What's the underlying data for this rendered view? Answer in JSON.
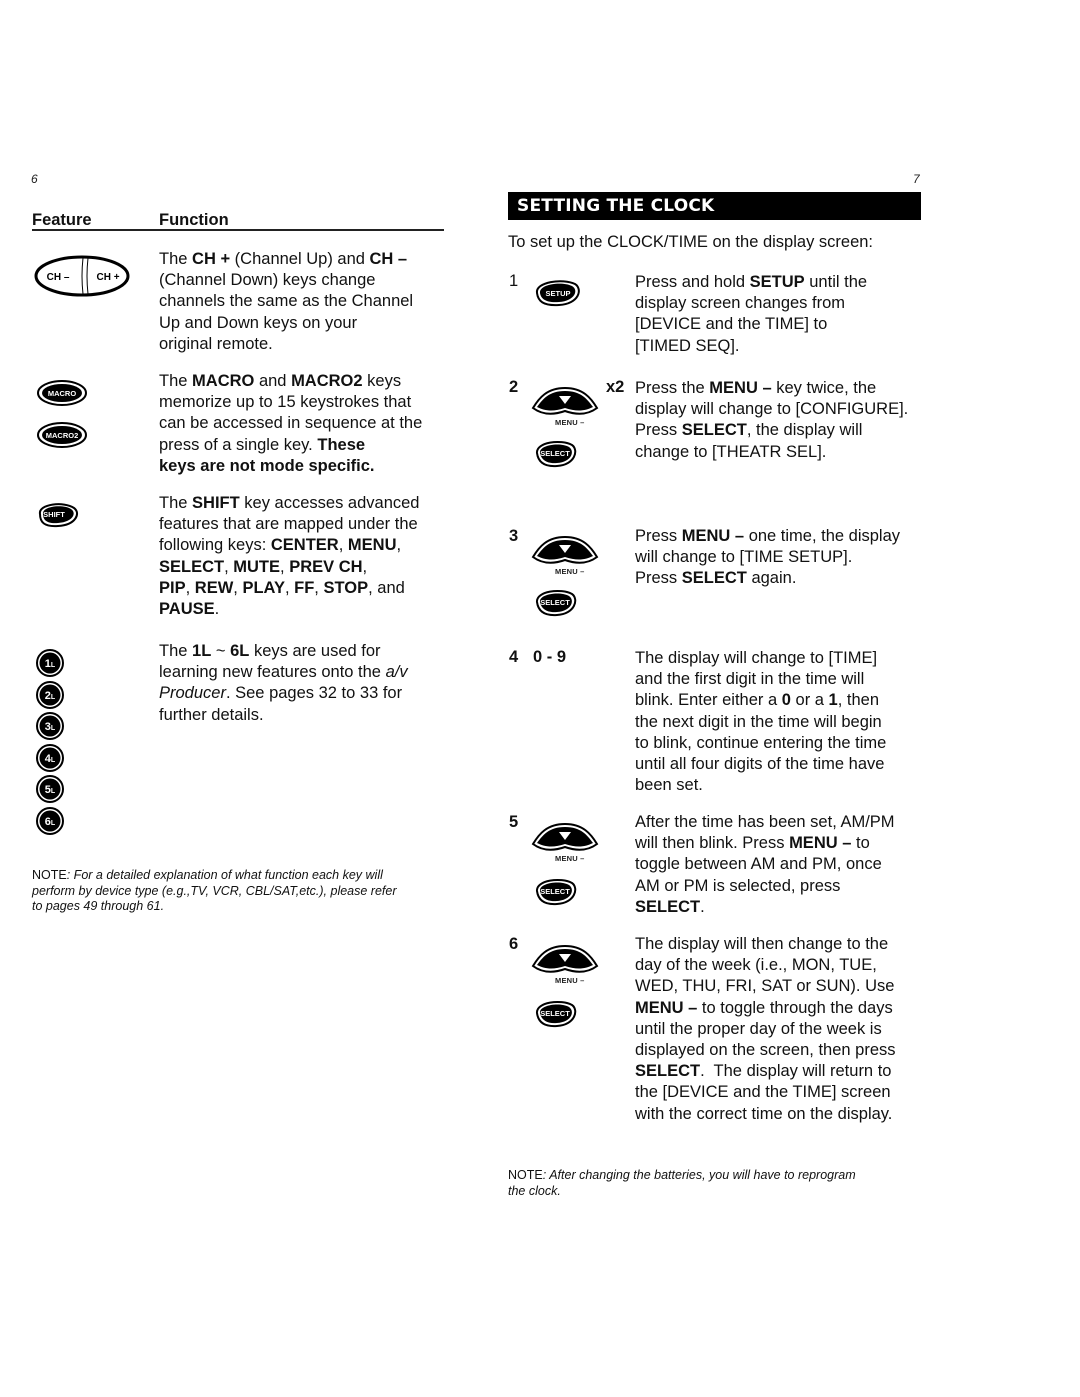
{
  "left_page": {
    "page_number": "6",
    "columns": {
      "feature": "Feature",
      "function": "Function"
    },
    "rows": [
      {
        "keys": [
          "CH –",
          "CH +"
        ],
        "lines": [
          [
            {
              "t": "The "
            },
            {
              "t": "CH +",
              "b": true
            },
            {
              "t": " (Channel Up) and "
            },
            {
              "t": "CH –",
              "b": true
            }
          ],
          [
            {
              "t": "(Channel Down) keys change"
            }
          ],
          [
            {
              "t": "channels the same as the Channel"
            }
          ],
          [
            {
              "t": "Up and Down keys on your"
            }
          ],
          [
            {
              "t": "original remote."
            }
          ]
        ]
      },
      {
        "keys": [
          "MACRO",
          "MACRO2"
        ],
        "lines": [
          [
            {
              "t": "The "
            },
            {
              "t": "MACRO",
              "b": true
            },
            {
              "t": " and "
            },
            {
              "t": "MACRO2",
              "b": true
            },
            {
              "t": " keys"
            }
          ],
          [
            {
              "t": "memorize up to 15 keystrokes that"
            }
          ],
          [
            {
              "t": "can be accessed in sequence at the"
            }
          ],
          [
            {
              "t": "press of a single key. "
            },
            {
              "t": "These",
              "b": true
            }
          ],
          [
            {
              "t": "keys are not mode specific.",
              "b": true
            }
          ]
        ]
      },
      {
        "keys": [
          "SHIFT"
        ],
        "lines": [
          [
            {
              "t": "The "
            },
            {
              "t": "SHIFT",
              "b": true
            },
            {
              "t": " key accesses advanced"
            }
          ],
          [
            {
              "t": "features that are mapped under the"
            }
          ],
          [
            {
              "t": "following keys: "
            },
            {
              "t": "CENTER",
              "b": true
            },
            {
              "t": ", "
            },
            {
              "t": "MENU",
              "b": true
            },
            {
              "t": ","
            }
          ],
          [
            {
              "t": "SELECT",
              "b": true
            },
            {
              "t": ", "
            },
            {
              "t": "MUTE",
              "b": true
            },
            {
              "t": ", "
            },
            {
              "t": "PREV CH",
              "b": true
            },
            {
              "t": ","
            }
          ],
          [
            {
              "t": "PIP",
              "b": true
            },
            {
              "t": ", "
            },
            {
              "t": "REW",
              "b": true
            },
            {
              "t": ", "
            },
            {
              "t": "PLAY",
              "b": true
            },
            {
              "t": ", "
            },
            {
              "t": "FF",
              "b": true
            },
            {
              "t": ", "
            },
            {
              "t": "STOP",
              "b": true
            },
            {
              "t": ", and"
            }
          ],
          [
            {
              "t": "PAUSE",
              "b": true
            },
            {
              "t": "."
            }
          ]
        ]
      },
      {
        "keys": [
          "1L",
          "2L",
          "3L",
          "4L",
          "5L",
          "6L"
        ],
        "lines": [
          [
            {
              "t": "The "
            },
            {
              "t": "1L",
              "b": true
            },
            {
              "t": " ~ "
            },
            {
              "t": "6L",
              "b": true
            },
            {
              "t": " keys are used for"
            }
          ],
          [
            {
              "t": "learning new features onto the "
            },
            {
              "t": "a/v",
              "i": true
            }
          ],
          [
            {
              "t": "Producer",
              "i": true
            },
            {
              "t": ". See pages 32 to 33 for"
            }
          ],
          [
            {
              "t": "further details."
            }
          ]
        ]
      }
    ],
    "note": {
      "label": "NOTE",
      "lines": [
        ": For a detailed explanation of what function each key will",
        "perform by device type (e.g.,TV, VCR, CBL/SAT,etc.), please refer",
        "to pages 49 through 61."
      ]
    }
  },
  "right_page": {
    "page_number": "7",
    "section_title": "SETTING THE CLOCK",
    "intro": "To set up the CLOCK/TIME on the display screen:",
    "menu_caption": "MENU –",
    "steps": [
      {
        "number": "1",
        "keys": [
          "SETUP"
        ],
        "lines": [
          [
            {
              "t": "Press and hold "
            },
            {
              "t": "SETUP",
              "b": true
            },
            {
              "t": " until the"
            }
          ],
          [
            {
              "t": "display screen changes from"
            }
          ],
          [
            {
              "t": "[DEVICE and the TIME] to"
            }
          ],
          [
            {
              "t": "[TIMED SEQ]."
            }
          ]
        ]
      },
      {
        "number": "2",
        "multiplier": "x2",
        "keys": [
          "MENU –",
          "SELECT"
        ],
        "lines": [
          [
            {
              "t": "Press the "
            },
            {
              "t": "MENU –",
              "b": true
            },
            {
              "t": " key twice, the"
            }
          ],
          [
            {
              "t": "display will change to [CONFIGURE]."
            }
          ],
          [
            {
              "t": "Press "
            },
            {
              "t": "SELECT",
              "b": true
            },
            {
              "t": ", the display will"
            }
          ],
          [
            {
              "t": "change to [THEATR SEL]."
            }
          ]
        ]
      },
      {
        "number": "3",
        "keys": [
          "MENU –",
          "SELECT"
        ],
        "lines": [
          [
            {
              "t": "Press "
            },
            {
              "t": "MENU –",
              "b": true
            },
            {
              "t": " one time, the display"
            }
          ],
          [
            {
              "t": "will change to [TIME SETUP]."
            }
          ],
          [
            {
              "t": "Press "
            },
            {
              "t": "SELECT",
              "b": true
            },
            {
              "t": " again."
            }
          ]
        ]
      },
      {
        "number": "4",
        "key_range": "0 - 9",
        "lines": [
          [
            {
              "t": "The display will change to [TIME]"
            }
          ],
          [
            {
              "t": "and the first digit in the time will"
            }
          ],
          [
            {
              "t": "blink. Enter either a "
            },
            {
              "t": "0",
              "b": true
            },
            {
              "t": " or a "
            },
            {
              "t": "1",
              "b": true
            },
            {
              "t": ", then"
            }
          ],
          [
            {
              "t": "the next digit in the time will begin"
            }
          ],
          [
            {
              "t": "to blink, continue entering the time"
            }
          ],
          [
            {
              "t": "until all four digits of the time have"
            }
          ],
          [
            {
              "t": "been set."
            }
          ]
        ]
      },
      {
        "number": "5",
        "keys": [
          "MENU –",
          "SELECT"
        ],
        "lines": [
          [
            {
              "t": "After the time has been set, AM/PM"
            }
          ],
          [
            {
              "t": "will then blink. Press "
            },
            {
              "t": "MENU –",
              "b": true
            },
            {
              "t": " to"
            }
          ],
          [
            {
              "t": "toggle between AM and PM, once"
            }
          ],
          [
            {
              "t": "AM or PM is selected, press"
            }
          ],
          [
            {
              "t": "SELECT",
              "b": true
            },
            {
              "t": "."
            }
          ]
        ]
      },
      {
        "number": "6",
        "keys": [
          "MENU –",
          "SELECT"
        ],
        "lines": [
          [
            {
              "t": "The display will then change to the"
            }
          ],
          [
            {
              "t": "day of the week (i.e., MON, TUE,"
            }
          ],
          [
            {
              "t": "WED, THU, FRI, SAT or SUN). Use"
            }
          ],
          [
            {
              "t": "MENU –",
              "b": true
            },
            {
              "t": " to toggle through the days"
            }
          ],
          [
            {
              "t": "until the proper day of the week is"
            }
          ],
          [
            {
              "t": "displayed on the screen, then press"
            }
          ],
          [
            {
              "t": "SELECT",
              "b": true
            },
            {
              "t": ".  The display will return to"
            }
          ],
          [
            {
              "t": "the [DEVICE and the TIME] screen"
            }
          ],
          [
            {
              "t": "with the correct time on the display."
            }
          ]
        ]
      }
    ],
    "note": {
      "label": "NOTE",
      "lines": [
        ":  After changing the batteries, you will have to reprogram",
        "the clock."
      ]
    }
  }
}
